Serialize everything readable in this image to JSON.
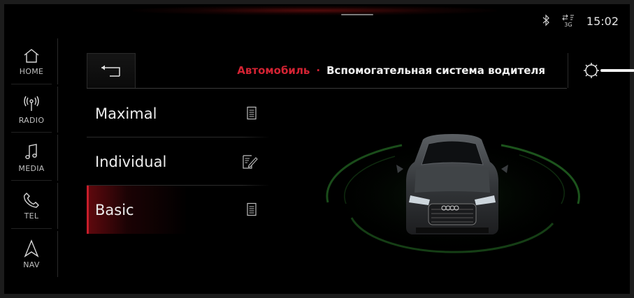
{
  "status": {
    "bluetooth_icon": "bluetooth-icon",
    "network_label": "3G",
    "time": "15:02"
  },
  "nav": [
    {
      "label": "HOME",
      "icon": "home-icon"
    },
    {
      "label": "RADIO",
      "icon": "radio-icon"
    },
    {
      "label": "MEDIA",
      "icon": "music-note-icon"
    },
    {
      "label": "TEL",
      "icon": "phone-icon"
    },
    {
      "label": "NAV",
      "icon": "navigation-arrow-icon"
    }
  ],
  "header": {
    "crumb": "Автомобиль",
    "separator": "·",
    "title": "Вспомогательная система водителя"
  },
  "modes": [
    {
      "label": "Maximal",
      "icon": "document-icon",
      "active": false
    },
    {
      "label": "Individual",
      "icon": "edit-document-icon",
      "active": false
    },
    {
      "label": "Basic",
      "icon": "document-icon",
      "active": true
    }
  ],
  "colors": {
    "accent": "#d42333",
    "ring": "#2f8a2f"
  }
}
